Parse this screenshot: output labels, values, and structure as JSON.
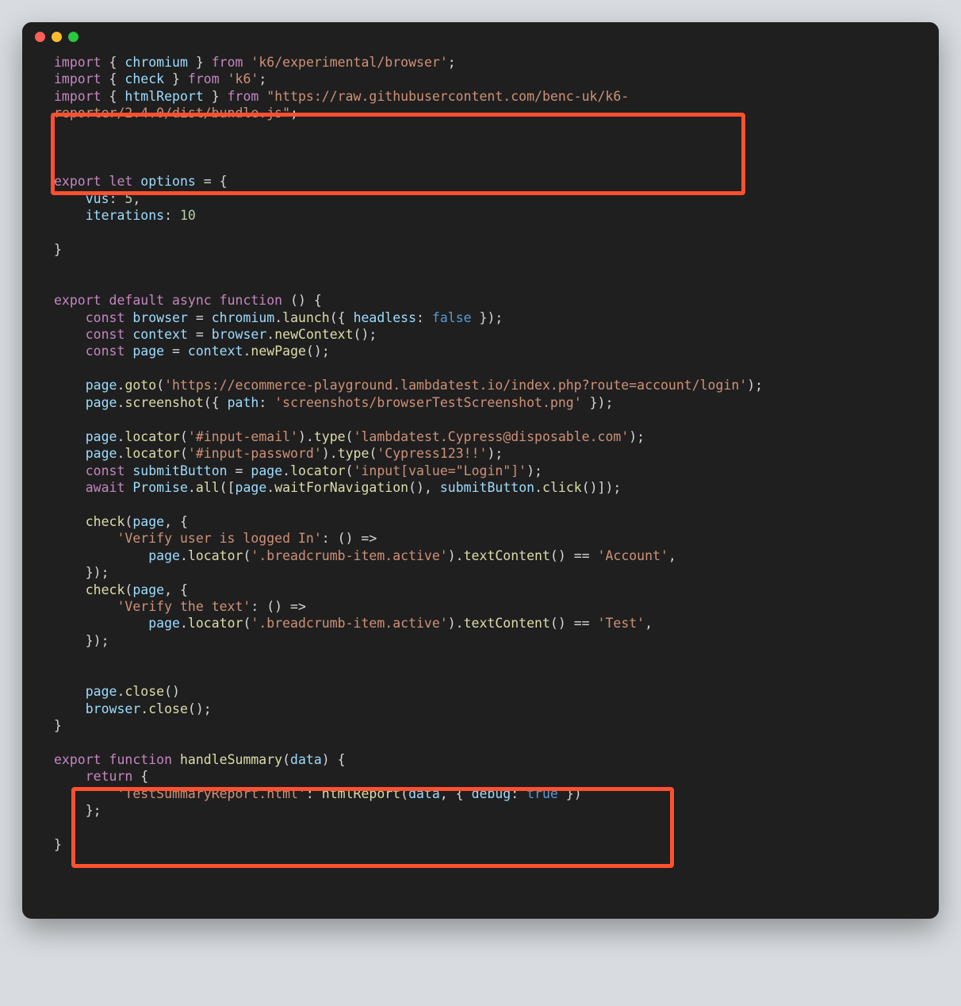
{
  "colors": {
    "keyword": "#c586c0",
    "function": "#dcdcaa",
    "identifier": "#9cdcfe",
    "string": "#ce9178",
    "number": "#b5cea8",
    "boolean": "#569cd6",
    "highlight_border": "#ff5030",
    "background": "#1f1f1f"
  },
  "code": {
    "import1": {
      "kw": "import",
      "id": "chromium",
      "from": "from",
      "str": "'k6/experimental/browser'"
    },
    "import2": {
      "kw": "import",
      "id": "check",
      "from": "from",
      "str": "'k6'"
    },
    "import3a": {
      "kw": "import",
      "id": "htmlReport",
      "from": "from",
      "strA": "\"https://raw.githubusercontent.com/benc-uk/k6-"
    },
    "import3b": {
      "strB": "reporter/2.4.0/dist/bundle.js\""
    },
    "exportlet": {
      "export": "export",
      "let": "let",
      "id": "options"
    },
    "vus": {
      "id": "vus",
      "num": "5"
    },
    "iters": {
      "id": "iterations",
      "num": "10"
    },
    "expdef": {
      "export": "export",
      "default": "default",
      "async": "async",
      "function": "function"
    },
    "browserln": {
      "const": "const",
      "id": "browser",
      "chromium": "chromium",
      "launch": "launch",
      "hkey": "headless",
      "false": "false"
    },
    "contextln": {
      "const": "const",
      "id": "context",
      "browser": "browser",
      "newctx": "newContext"
    },
    "pageln": {
      "const": "const",
      "id": "page",
      "ctx": "context",
      "newpage": "newPage"
    },
    "goto": {
      "page": "page",
      "goto": "goto",
      "url": "'https://ecommerce-playground.lambdatest.io/index.php?route=account/login'"
    },
    "shot": {
      "page": "page",
      "ss": "screenshot",
      "pathkey": "path",
      "pathval": "'screenshots/browserTestScreenshot.png'"
    },
    "email": {
      "page": "page",
      "loc": "locator",
      "sel": "'#input-email'",
      "type": "type",
      "val": "'lambdatest.Cypress@disposable.com'"
    },
    "pwd": {
      "page": "page",
      "loc": "locator",
      "sel": "'#input-password'",
      "type": "type",
      "val": "'Cypress123!!'"
    },
    "submit": {
      "const": "const",
      "id": "submitButton",
      "page": "page",
      "loc": "locator",
      "sel": "'input[value=\"Login\"]'"
    },
    "awaitln": {
      "await": "await",
      "prom": "Promise",
      "all": "all",
      "page": "page",
      "wfn": "waitForNavigation",
      "sb": "submitButton",
      "click": "click"
    },
    "check1a": {
      "check": "check",
      "page": "page"
    },
    "check1b": {
      "key": "'Verify user is logged In'"
    },
    "check1c": {
      "page": "page",
      "loc": "locator",
      "sel": "'.breadcrumb-item.active'",
      "tc": "textContent",
      "eq": "'Account'"
    },
    "check2b": {
      "key": "'Verify the text'"
    },
    "check2c": {
      "page": "page",
      "loc": "locator",
      "sel": "'.breadcrumb-item.active'",
      "tc": "textContent",
      "eq": "'Test'"
    },
    "closep": {
      "page": "page",
      "close": "close"
    },
    "closeb": {
      "browser": "browser",
      "close": "close"
    },
    "handle": {
      "export": "export",
      "function": "function",
      "name": "handleSummary",
      "arg": "data"
    },
    "ret": {
      "return": "return"
    },
    "retln": {
      "key": "'TestSummaryReport.html'",
      "fn": "htmlReport",
      "data": "data",
      "dbg": "debug",
      "true": "true"
    }
  }
}
